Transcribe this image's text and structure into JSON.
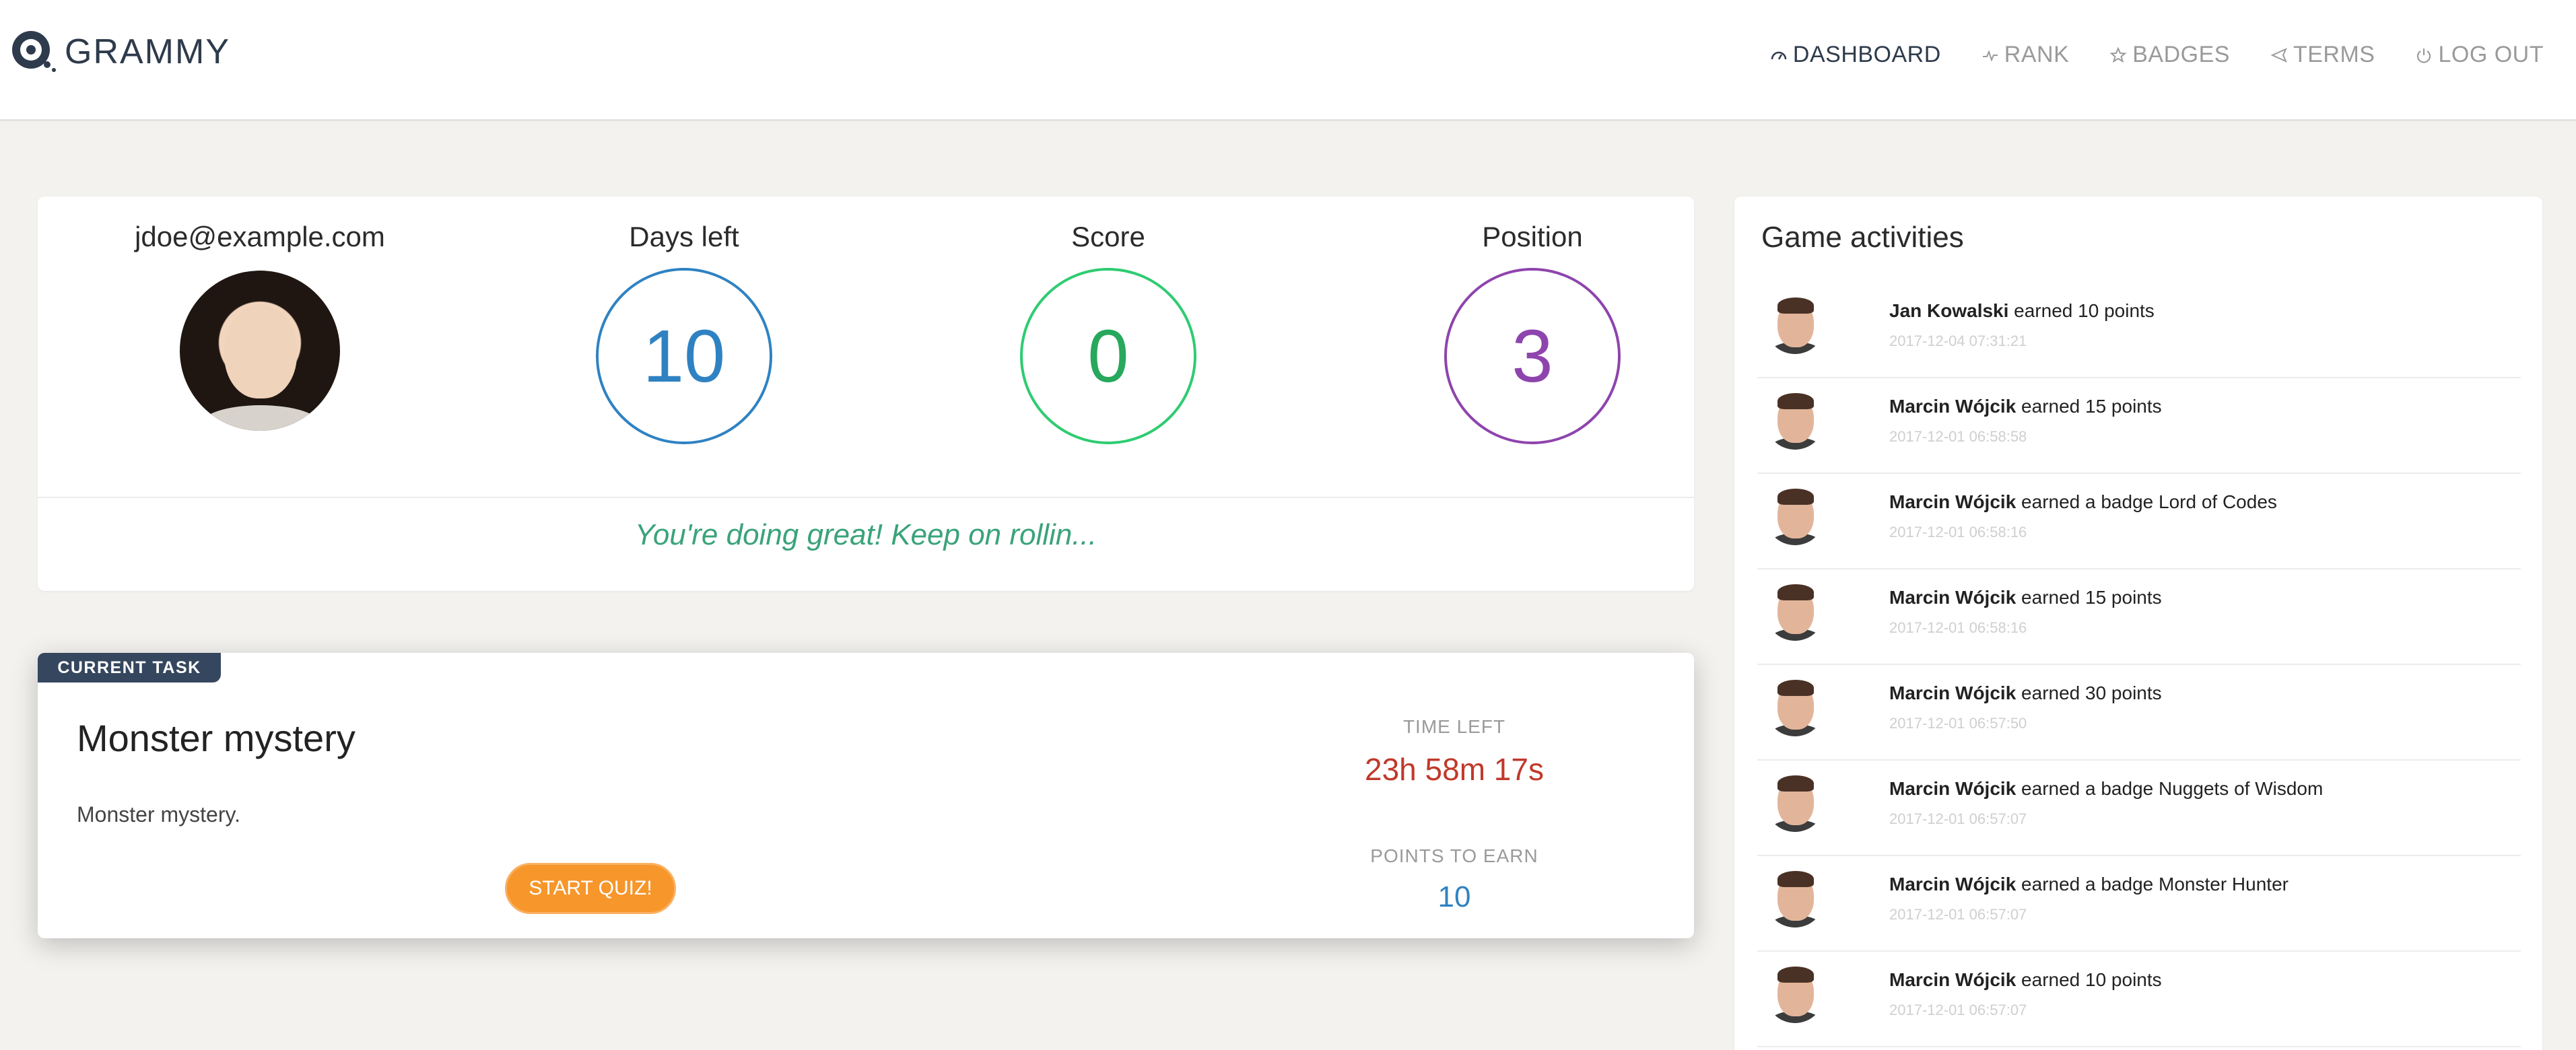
{
  "header": {
    "brand": "GRAMMY",
    "nav": [
      {
        "label": "DASHBOARD",
        "icon": "dashboard-icon",
        "active": true
      },
      {
        "label": "RANK",
        "icon": "pulse-icon",
        "active": false
      },
      {
        "label": "BADGES",
        "icon": "star-icon",
        "active": false
      },
      {
        "label": "TERMS",
        "icon": "paper-plane-icon",
        "active": false
      },
      {
        "label": "LOG OUT",
        "icon": "power-icon",
        "active": false
      }
    ]
  },
  "stats": {
    "user_email": "jdoe@example.com",
    "days_left_label": "Days left",
    "days_left_value": "10",
    "score_label": "Score",
    "score_value": "0",
    "position_label": "Position",
    "position_value": "3",
    "message": "You're doing great! Keep on rollin...",
    "colors": {
      "days_left": "#2f82c2",
      "score": "#2ecc71",
      "position": "#8e44ad"
    }
  },
  "task": {
    "tag": "CURRENT TASK",
    "title": "Monster mystery",
    "description": "Monster mystery.",
    "start_button": "START QUIZ!",
    "time_left_label": "TIME LEFT",
    "time_left_value": "23h 58m 17s",
    "points_label": "POINTS TO EARN",
    "points_value": "10"
  },
  "activities": {
    "title": "Game activities",
    "items": [
      {
        "name": "Jan Kowalski",
        "action": " earned 10 points",
        "time": "2017-12-04 07:31:21"
      },
      {
        "name": "Marcin Wójcik",
        "action": " earned 15 points",
        "time": "2017-12-01 06:58:58"
      },
      {
        "name": "Marcin Wójcik",
        "action": " earned a badge Lord of Codes",
        "time": "2017-12-01 06:58:16"
      },
      {
        "name": "Marcin Wójcik",
        "action": " earned 15 points",
        "time": "2017-12-01 06:58:16"
      },
      {
        "name": "Marcin Wójcik",
        "action": " earned 30 points",
        "time": "2017-12-01 06:57:50"
      },
      {
        "name": "Marcin Wójcik",
        "action": " earned a badge Nuggets of Wisdom",
        "time": "2017-12-01 06:57:07"
      },
      {
        "name": "Marcin Wójcik",
        "action": " earned a badge Monster Hunter",
        "time": "2017-12-01 06:57:07"
      },
      {
        "name": "Marcin Wójcik",
        "action": " earned 10 points",
        "time": "2017-12-01 06:57:07"
      }
    ]
  }
}
